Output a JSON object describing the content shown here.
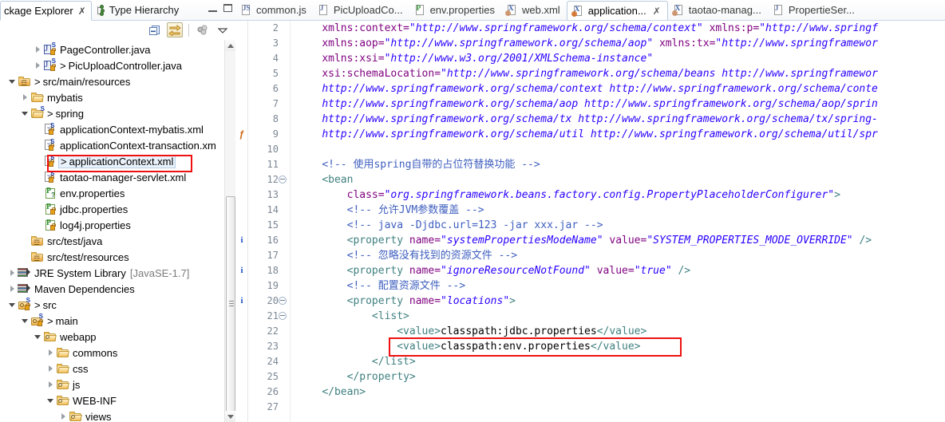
{
  "left_panel": {
    "tabs": [
      {
        "label": "ckage Explorer",
        "full_label": "Package Explorer",
        "active": true,
        "closable": true
      },
      {
        "label": "Type Hierarchy",
        "active": false,
        "closable": false
      }
    ],
    "window_buttons": {
      "minimize": "minimize-icon",
      "maximize": "maximize-icon"
    },
    "toolbar": [
      {
        "name": "collapse-all-button",
        "icon": "collapse-all-icon",
        "pressed": false
      },
      {
        "name": "link-with-editor-button",
        "icon": "link-editor-icon",
        "pressed": true
      },
      {
        "name": "view-menu-filters-button",
        "icon": "filters-icon",
        "pressed": false
      },
      {
        "name": "view-menu-button",
        "icon": "chevron-down-icon",
        "pressed": false
      }
    ],
    "tree": [
      {
        "indent": 2,
        "arrow": "right",
        "icon": "java-file",
        "gt": false,
        "label": "PageController.java",
        "gray": ""
      },
      {
        "indent": 2,
        "arrow": "right",
        "icon": "java-file",
        "gt": true,
        "label": "PicUploadController.java",
        "gray": ""
      },
      {
        "indent": 0,
        "arrow": "down",
        "icon": "source-folder",
        "gt": true,
        "label": "src/main/resources",
        "gray": ""
      },
      {
        "indent": 1,
        "arrow": "right",
        "icon": "package",
        "gt": false,
        "label": "mybatis",
        "gray": ""
      },
      {
        "indent": 1,
        "arrow": "down",
        "icon": "package-s",
        "gt": true,
        "label": "spring",
        "gray": ""
      },
      {
        "indent": 2,
        "arrow": "none",
        "icon": "xml-spring",
        "gt": false,
        "label": "applicationContext-mybatis.xml",
        "gray": ""
      },
      {
        "indent": 2,
        "arrow": "none",
        "icon": "xml-spring",
        "gt": false,
        "label": "applicationContext-transaction.xm",
        "gray": ""
      },
      {
        "indent": 2,
        "arrow": "none",
        "icon": "xml-spring",
        "gt": true,
        "label": "applicationContext.xml",
        "gray": "",
        "selected": true,
        "highlighted": true
      },
      {
        "indent": 2,
        "arrow": "none",
        "icon": "xml-spring",
        "gt": false,
        "label": "taotao-manager-servlet.xml",
        "gray": ""
      },
      {
        "indent": 2,
        "arrow": "none",
        "icon": "properties-q",
        "gt": false,
        "label": "env.properties",
        "gray": ""
      },
      {
        "indent": 2,
        "arrow": "none",
        "icon": "properties",
        "gt": false,
        "label": "jdbc.properties",
        "gray": ""
      },
      {
        "indent": 2,
        "arrow": "none",
        "icon": "properties",
        "gt": false,
        "label": "log4j.properties",
        "gray": ""
      },
      {
        "indent": 1,
        "arrow": "none",
        "icon": "source-folder-plain",
        "gt": false,
        "label": "src/test/java",
        "gray": ""
      },
      {
        "indent": 1,
        "arrow": "none",
        "icon": "source-folder-plain",
        "gt": false,
        "label": "src/test/resources",
        "gray": ""
      },
      {
        "indent": 0,
        "arrow": "right",
        "icon": "library",
        "gt": false,
        "label": "JRE System Library",
        "gray": "[JavaSE-1.7]"
      },
      {
        "indent": 0,
        "arrow": "right",
        "icon": "library",
        "gt": false,
        "label": "Maven Dependencies",
        "gray": ""
      },
      {
        "indent": 0,
        "arrow": "down",
        "icon": "src-pkg",
        "gt": true,
        "label": "src",
        "gray": ""
      },
      {
        "indent": 1,
        "arrow": "down",
        "icon": "src-pkg",
        "gt": true,
        "label": "main",
        "gray": ""
      },
      {
        "indent": 2,
        "arrow": "down",
        "icon": "webfolder",
        "gt": false,
        "label": "webapp",
        "gray": ""
      },
      {
        "indent": 3,
        "arrow": "right",
        "icon": "package",
        "gt": false,
        "label": "commons",
        "gray": ""
      },
      {
        "indent": 3,
        "arrow": "right",
        "icon": "package",
        "gt": false,
        "label": "css",
        "gray": ""
      },
      {
        "indent": 3,
        "arrow": "right",
        "icon": "webfolder",
        "gt": false,
        "label": "js",
        "gray": ""
      },
      {
        "indent": 3,
        "arrow": "down",
        "icon": "webfolder",
        "gt": false,
        "label": "WEB-INF",
        "gray": ""
      },
      {
        "indent": 4,
        "arrow": "right",
        "icon": "webfolder",
        "gt": false,
        "label": "views",
        "gray": ""
      }
    ]
  },
  "editor": {
    "tabs": [
      {
        "label": "common.js",
        "icon_letter": "JS",
        "icon_color": "#5a6fa5",
        "active": false,
        "closable": false
      },
      {
        "label": "PicUploadCo...",
        "icon_letter": "J",
        "icon_color": "#5a6fa5",
        "active": false,
        "closable": false
      },
      {
        "label": "env.properties",
        "icon_letter": "P",
        "icon_color": "#2f8f2f",
        "active": false,
        "closable": false
      },
      {
        "label": "web.xml",
        "icon_letter": "X",
        "icon_color": "#3a5fa5",
        "active": false,
        "closable": false
      },
      {
        "label": "application...",
        "icon_letter": "X",
        "icon_color": "#3a5fa5",
        "active": true,
        "closable": true
      },
      {
        "label": "taotao-manag...",
        "icon_letter": "X",
        "icon_color": "#3a5fa5",
        "active": false,
        "closable": false
      },
      {
        "label": "PropertieSer...",
        "icon_letter": "J",
        "icon_color": "#5a6fa5",
        "active": false,
        "closable": false
      }
    ],
    "close_glyph": "⌧",
    "lines": [
      {
        "n": 2,
        "ann": "",
        "fold": false,
        "tokens": [
          {
            "t": "plain",
            "v": "    "
          },
          {
            "t": "attr",
            "v": "xmlns:context="
          },
          {
            "t": "val",
            "v": "\"http://www.springframework.org/schema/context\""
          },
          {
            "t": "plain",
            "v": " "
          },
          {
            "t": "attr",
            "v": "xmlns:p="
          },
          {
            "t": "val",
            "v": "\"http://www.springf"
          }
        ]
      },
      {
        "n": 3,
        "ann": "",
        "fold": false,
        "tokens": [
          {
            "t": "plain",
            "v": "    "
          },
          {
            "t": "attr",
            "v": "xmlns:aop="
          },
          {
            "t": "val",
            "v": "\"http://www.springframework.org/schema/aop\""
          },
          {
            "t": "plain",
            "v": " "
          },
          {
            "t": "attr",
            "v": "xmlns:tx="
          },
          {
            "t": "val",
            "v": "\"http://www.springframewor"
          }
        ]
      },
      {
        "n": 4,
        "ann": "",
        "fold": false,
        "tokens": [
          {
            "t": "plain",
            "v": "    "
          },
          {
            "t": "attr",
            "v": "xmlns:xsi="
          },
          {
            "t": "val",
            "v": "\"http://www.w3.org/2001/XMLSchema-instance\""
          }
        ]
      },
      {
        "n": 5,
        "ann": "",
        "fold": false,
        "tokens": [
          {
            "t": "plain",
            "v": "    "
          },
          {
            "t": "attr",
            "v": "xsi:schemaLocation="
          },
          {
            "t": "val",
            "v": "\"http://www.springframework.org/schema/beans http://www.springframewor"
          }
        ]
      },
      {
        "n": 6,
        "ann": "",
        "fold": false,
        "tokens": [
          {
            "t": "plain",
            "v": "    "
          },
          {
            "t": "val",
            "v": "http://www.springframework.org/schema/context http://www.springframework.org/schema/conte"
          }
        ]
      },
      {
        "n": 7,
        "ann": "",
        "fold": false,
        "tokens": [
          {
            "t": "plain",
            "v": "    "
          },
          {
            "t": "val",
            "v": "http://www.springframework.org/schema/aop http://www.springframework.org/schema/aop/sprin"
          }
        ]
      },
      {
        "n": 8,
        "ann": "",
        "fold": false,
        "tokens": [
          {
            "t": "plain",
            "v": "    "
          },
          {
            "t": "val",
            "v": "http://www.springframework.org/schema/tx http://www.springframework.org/schema/tx/spring-"
          }
        ]
      },
      {
        "n": 9,
        "ann": "warn",
        "fold": false,
        "tokens": [
          {
            "t": "plain",
            "v": "    "
          },
          {
            "t": "val",
            "v": "http://www.springframework.org/schema/util http://www.springframework.org/schema/util/spr"
          }
        ]
      },
      {
        "n": 10,
        "ann": "",
        "fold": false,
        "tokens": []
      },
      {
        "n": 11,
        "ann": "",
        "fold": false,
        "tokens": [
          {
            "t": "plain",
            "v": "    "
          },
          {
            "t": "cmt",
            "v": "<!-- 使用spring自带的占位符替换功能 -->"
          }
        ]
      },
      {
        "n": 12,
        "ann": "",
        "fold": true,
        "tokens": [
          {
            "t": "plain",
            "v": "    "
          },
          {
            "t": "tag",
            "v": "<bean"
          }
        ]
      },
      {
        "n": 13,
        "ann": "",
        "fold": false,
        "tokens": [
          {
            "t": "plain",
            "v": "        "
          },
          {
            "t": "attr",
            "v": "class="
          },
          {
            "t": "val",
            "v": "\"org.springframework.beans.factory.config.PropertyPlaceholderConfigurer\""
          },
          {
            "t": "tag",
            "v": ">"
          }
        ]
      },
      {
        "n": 14,
        "ann": "",
        "fold": false,
        "tokens": [
          {
            "t": "plain",
            "v": "        "
          },
          {
            "t": "cmt",
            "v": "<!-- 允许JVM参数覆盖 -->"
          }
        ]
      },
      {
        "n": 15,
        "ann": "",
        "fold": false,
        "tokens": [
          {
            "t": "plain",
            "v": "        "
          },
          {
            "t": "cmt",
            "v": "<!-- java -Djdbc.url=123 -jar xxx.jar -->"
          }
        ]
      },
      {
        "n": 16,
        "ann": "info",
        "fold": false,
        "tokens": [
          {
            "t": "plain",
            "v": "        "
          },
          {
            "t": "tag",
            "v": "<property"
          },
          {
            "t": "plain",
            "v": " "
          },
          {
            "t": "attr",
            "v": "name="
          },
          {
            "t": "val",
            "v": "\"systemPropertiesModeName\""
          },
          {
            "t": "plain",
            "v": " "
          },
          {
            "t": "attr",
            "v": "value="
          },
          {
            "t": "val",
            "v": "\"SYSTEM_PROPERTIES_MODE_OVERRIDE\""
          },
          {
            "t": "plain",
            "v": " "
          },
          {
            "t": "tag",
            "v": "/>"
          }
        ]
      },
      {
        "n": 17,
        "ann": "",
        "fold": false,
        "tokens": [
          {
            "t": "plain",
            "v": "        "
          },
          {
            "t": "cmt",
            "v": "<!-- 忽略没有找到的资源文件 -->"
          }
        ]
      },
      {
        "n": 18,
        "ann": "info",
        "fold": false,
        "tokens": [
          {
            "t": "plain",
            "v": "        "
          },
          {
            "t": "tag",
            "v": "<property"
          },
          {
            "t": "plain",
            "v": " "
          },
          {
            "t": "attr",
            "v": "name="
          },
          {
            "t": "val",
            "v": "\"ignoreResourceNotFound\""
          },
          {
            "t": "plain",
            "v": " "
          },
          {
            "t": "attr",
            "v": "value="
          },
          {
            "t": "val",
            "v": "\"true\""
          },
          {
            "t": "plain",
            "v": " "
          },
          {
            "t": "tag",
            "v": "/>"
          }
        ]
      },
      {
        "n": 19,
        "ann": "",
        "fold": false,
        "tokens": [
          {
            "t": "plain",
            "v": "        "
          },
          {
            "t": "cmt",
            "v": "<!-- 配置资源文件 -->"
          }
        ]
      },
      {
        "n": 20,
        "ann": "info",
        "fold": true,
        "tokens": [
          {
            "t": "plain",
            "v": "        "
          },
          {
            "t": "tag",
            "v": "<property"
          },
          {
            "t": "plain",
            "v": " "
          },
          {
            "t": "attr",
            "v": "name="
          },
          {
            "t": "val",
            "v": "\"locations\""
          },
          {
            "t": "tag",
            "v": ">"
          }
        ]
      },
      {
        "n": 21,
        "ann": "",
        "fold": true,
        "tokens": [
          {
            "t": "plain",
            "v": "            "
          },
          {
            "t": "tag",
            "v": "<list>"
          }
        ]
      },
      {
        "n": 22,
        "ann": "",
        "fold": false,
        "tokens": [
          {
            "t": "plain",
            "v": "                "
          },
          {
            "t": "tag",
            "v": "<value>"
          },
          {
            "t": "txt",
            "v": "classpath:jdbc.properties"
          },
          {
            "t": "tag",
            "v": "</value>"
          }
        ]
      },
      {
        "n": 23,
        "ann": "",
        "fold": false,
        "highlighted": true,
        "tokens": [
          {
            "t": "plain",
            "v": "                "
          },
          {
            "t": "tag",
            "v": "<value>"
          },
          {
            "t": "txt",
            "v": "classpath:env.properties"
          },
          {
            "t": "tag",
            "v": "</value>"
          }
        ]
      },
      {
        "n": 24,
        "ann": "",
        "fold": false,
        "tokens": [
          {
            "t": "plain",
            "v": "            "
          },
          {
            "t": "tag",
            "v": "</list>"
          }
        ]
      },
      {
        "n": 25,
        "ann": "",
        "fold": false,
        "tokens": [
          {
            "t": "plain",
            "v": "        "
          },
          {
            "t": "tag",
            "v": "</property>"
          }
        ]
      },
      {
        "n": 26,
        "ann": "",
        "fold": false,
        "tokens": [
          {
            "t": "plain",
            "v": "    "
          },
          {
            "t": "tag",
            "v": "</bean>"
          }
        ]
      },
      {
        "n": 27,
        "ann": "",
        "fold": false,
        "tokens": []
      }
    ]
  },
  "colors": {
    "tag": "#3f7f7f",
    "attribute": "#7f007f",
    "value": "#2a00ff",
    "comment": "#3f5fbf",
    "highlight_box": "#ee1111",
    "selection_bg": "#eaf2fb"
  }
}
